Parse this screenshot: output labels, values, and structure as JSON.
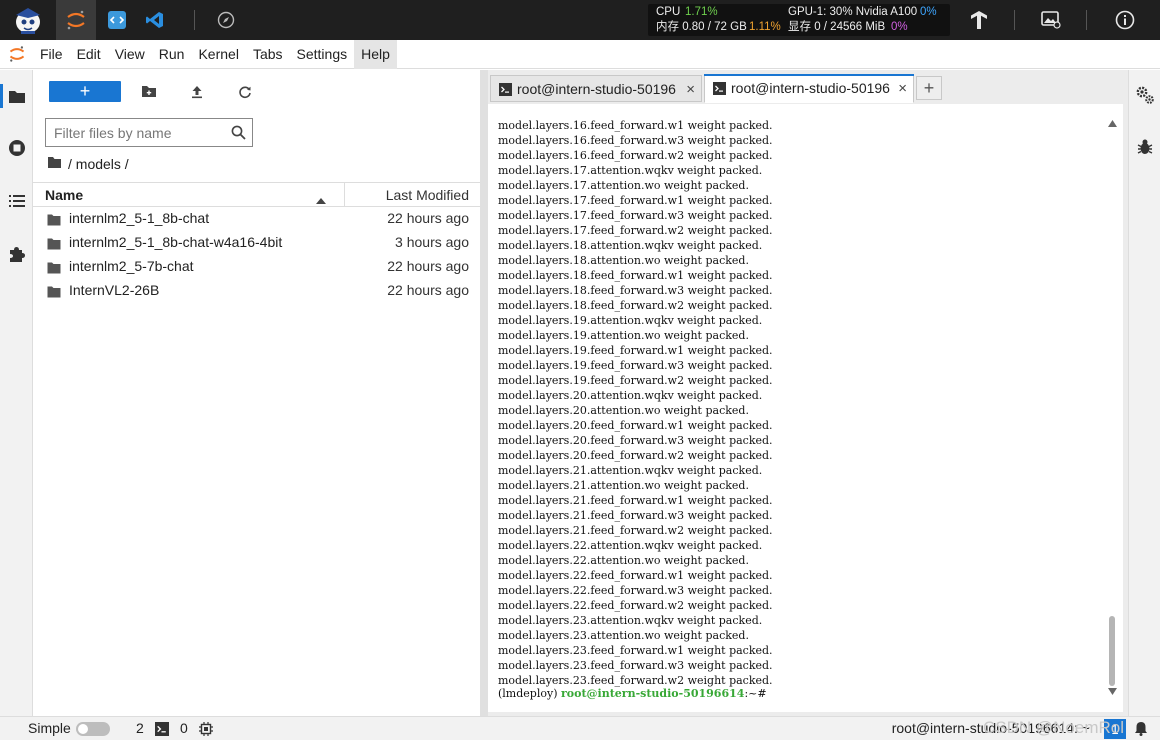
{
  "topbar": {
    "stats": {
      "cpu_label": "CPU",
      "cpu_value": "1.71%",
      "mem_label": "内存 0.80 / 72 GB",
      "mem_value": "1.11%",
      "gpu_label": "GPU-1: 30% Nvidia A100",
      "gpu_value": "0%",
      "vram_label": "显存 0 / 24566 MiB",
      "vram_value": "0%"
    }
  },
  "menu": {
    "items": [
      "File",
      "Edit",
      "View",
      "Run",
      "Kernel",
      "Tabs",
      "Settings",
      "Help"
    ],
    "active": "Help"
  },
  "filebrowser": {
    "new_label": "+",
    "filter_placeholder": "Filter files by name",
    "breadcrumb": "/ models /",
    "col_name": "Name",
    "col_modified": "Last Modified",
    "files": [
      {
        "name": "internlm2_5-1_8b-chat",
        "modified": "22 hours ago"
      },
      {
        "name": "internlm2_5-1_8b-chat-w4a16-4bit",
        "modified": "3 hours ago"
      },
      {
        "name": "internlm2_5-7b-chat",
        "modified": "22 hours ago"
      },
      {
        "name": "InternVL2-26B",
        "modified": "22 hours ago"
      }
    ]
  },
  "terminal": {
    "tabs": [
      {
        "label": "root@intern-studio-50196",
        "close": "×"
      },
      {
        "label": "root@intern-studio-50196",
        "close": "×"
      }
    ],
    "add_tab": "+",
    "lines": [
      "model.layers.16.feed_forward.w1 weight packed.",
      "model.layers.16.feed_forward.w3 weight packed.",
      "model.layers.16.feed_forward.w2 weight packed.",
      "model.layers.17.attention.wqkv weight packed.",
      "model.layers.17.attention.wo weight packed.",
      "model.layers.17.feed_forward.w1 weight packed.",
      "model.layers.17.feed_forward.w3 weight packed.",
      "model.layers.17.feed_forward.w2 weight packed.",
      "model.layers.18.attention.wqkv weight packed.",
      "model.layers.18.attention.wo weight packed.",
      "model.layers.18.feed_forward.w1 weight packed.",
      "model.layers.18.feed_forward.w3 weight packed.",
      "model.layers.18.feed_forward.w2 weight packed.",
      "model.layers.19.attention.wqkv weight packed.",
      "model.layers.19.attention.wo weight packed.",
      "model.layers.19.feed_forward.w1 weight packed.",
      "model.layers.19.feed_forward.w3 weight packed.",
      "model.layers.19.feed_forward.w2 weight packed.",
      "model.layers.20.attention.wqkv weight packed.",
      "model.layers.20.attention.wo weight packed.",
      "model.layers.20.feed_forward.w1 weight packed.",
      "model.layers.20.feed_forward.w3 weight packed.",
      "model.layers.20.feed_forward.w2 weight packed.",
      "model.layers.21.attention.wqkv weight packed.",
      "model.layers.21.attention.wo weight packed.",
      "model.layers.21.feed_forward.w1 weight packed.",
      "model.layers.21.feed_forward.w3 weight packed.",
      "model.layers.21.feed_forward.w2 weight packed.",
      "model.layers.22.attention.wqkv weight packed.",
      "model.layers.22.attention.wo weight packed.",
      "model.layers.22.feed_forward.w1 weight packed.",
      "model.layers.22.feed_forward.w3 weight packed.",
      "model.layers.22.feed_forward.w2 weight packed.",
      "model.layers.23.attention.wqkv weight packed.",
      "model.layers.23.attention.wo weight packed.",
      "model.layers.23.feed_forward.w1 weight packed.",
      "model.layers.23.feed_forward.w3 weight packed.",
      "model.layers.23.feed_forward.w2 weight packed."
    ],
    "prompt_env": "(lmdeploy) ",
    "prompt_user": "root@intern-studio-50196614",
    "prompt_tail": ":~# "
  },
  "statusbar": {
    "simple_label": "Simple",
    "count_terminals": "2",
    "count_kernels": "0",
    "right_label": "root@intern-studio-50196614: ~",
    "badge": "1",
    "watermark": "CSDN @NoemRol"
  },
  "colors": {
    "accent": "#1976d2",
    "prompt_green": "#38a836",
    "topbar_bg": "#1f1f1f"
  }
}
